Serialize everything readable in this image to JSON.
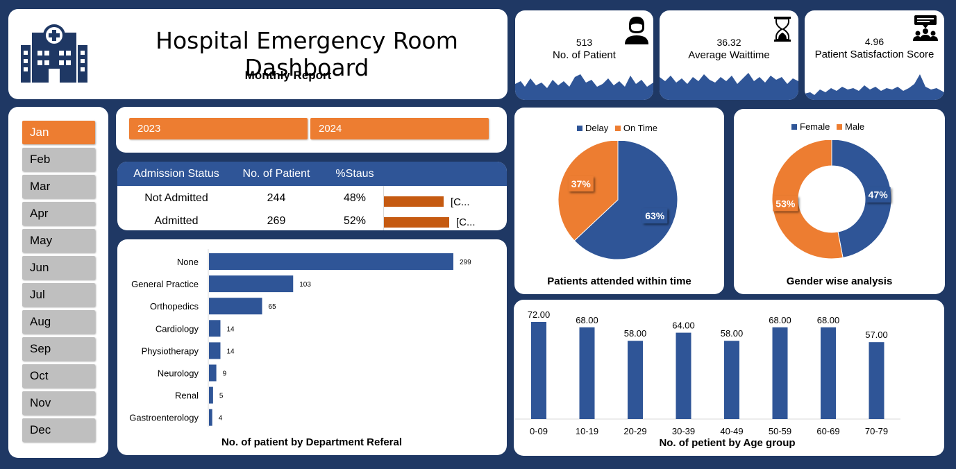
{
  "header": {
    "title": "Hospital Emergency Room Dashboard",
    "subtitle": "Monthly Report",
    "icon": "hospital-icon"
  },
  "kpis": [
    {
      "value": "513",
      "label": "No. of Patient",
      "icon": "patient-icon"
    },
    {
      "value": "36.32",
      "label": "Average Waittime",
      "icon": "hourglass-icon"
    },
    {
      "value": "4.96",
      "label": "Patient Satisfaction Score",
      "icon": "audience-icon"
    }
  ],
  "months": [
    "Jan",
    "Feb",
    "Mar",
    "Apr",
    "May",
    "Jun",
    "Jul",
    "Aug",
    "Sep",
    "Oct",
    "Nov",
    "Dec"
  ],
  "active_month": "Jan",
  "years": [
    "2023",
    "2024"
  ],
  "admission": {
    "headers": [
      "Admission Status",
      "No. of Patient",
      "%Staus"
    ],
    "rows": [
      {
        "status": "Not Admitted",
        "count": "244",
        "pct": "48%",
        "fraction": 0.48,
        "bar_label": "[C..."
      },
      {
        "status": "Admitted",
        "count": "269",
        "pct": "52%",
        "fraction": 0.52,
        "bar_label": "[C..."
      }
    ]
  },
  "colors": {
    "blue": "#2f5597",
    "orange": "#ed7d31",
    "dark_orange": "#c55a11",
    "navy": "#1f3864"
  },
  "chart_data": [
    {
      "type": "bar",
      "orientation": "horizontal",
      "title": "No. of patient by Department Referal",
      "categories": [
        "None",
        "General Practice",
        "Orthopedics",
        "Cardiology",
        "Physiotherapy",
        "Neurology",
        "Renal",
        "Gastroenterology"
      ],
      "values": [
        299,
        103,
        65,
        14,
        14,
        9,
        5,
        4
      ],
      "xlim": [
        0,
        299
      ]
    },
    {
      "type": "pie",
      "title": "Patients attended within time",
      "labels": [
        "Delay",
        "On Time"
      ],
      "values": [
        63,
        37
      ],
      "value_labels": [
        "63%",
        "37%"
      ],
      "legend": "top"
    },
    {
      "type": "pie",
      "donut": true,
      "title": "Gender wise analysis",
      "labels": [
        "Female",
        "Male"
      ],
      "values": [
        47,
        53
      ],
      "value_labels": [
        "47%",
        "53%"
      ],
      "legend": "top"
    },
    {
      "type": "bar",
      "title": "No. of petient by Age group",
      "categories": [
        "0-09",
        "10-19",
        "20-29",
        "30-39",
        "40-49",
        "50-59",
        "60-69",
        "70-79"
      ],
      "values": [
        72,
        68,
        58,
        64,
        58,
        68,
        68,
        57
      ],
      "value_labels": [
        "72.00",
        "68.00",
        "58.00",
        "64.00",
        "58.00",
        "68.00",
        "68.00",
        "57.00"
      ],
      "ylim": [
        0,
        72
      ]
    }
  ]
}
